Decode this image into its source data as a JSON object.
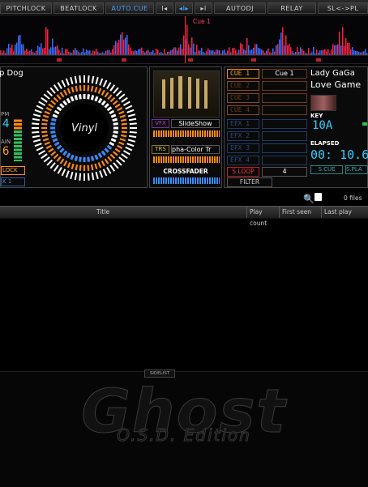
{
  "toolbar": {
    "buttons": [
      "PITCHLOCK",
      "BEATLOCK",
      "AUTO.CUE",
      "I◂",
      "◂I▸",
      "▸I",
      "AUTODJ",
      "RELAY",
      "SL<->PL"
    ]
  },
  "waveform": {
    "cue_label": "Cue 1"
  },
  "deck_left": {
    "title_fragment": "p Dog",
    "bpm_label": "PM",
    "bpm_digit": "4",
    "gain_label": "AIN",
    "gain_digit": "6",
    "lock_label": "LOCK",
    "bottom_label": "K 1",
    "platter_label": "Vinyl"
  },
  "mixer": {
    "vfx_label": "VFX",
    "vfx_value": "SlideShow",
    "trs_label": "TRS",
    "trs_value": "pha-Color Tr",
    "crossfader_label": "CROSSFADER"
  },
  "cues": {
    "buttons": [
      "CUE 1",
      "CUE 2",
      "CUE 3",
      "CUE 4"
    ],
    "slot1": "Cue 1",
    "efx": [
      "EFX 1",
      "EFX 2",
      "EFX 3",
      "EFX 4"
    ],
    "sloop_label": "S.LOOP",
    "sloop_value": "4",
    "filter_label": "FILTER"
  },
  "deck_right": {
    "artist": "Lady GaGa",
    "title": "Love Game",
    "key_label": "KEY",
    "key_value": "10A",
    "elapsed_label": "ELAPSED",
    "elapsed_value": "00: 10.6",
    "scue_label": "S.CUE",
    "splay_label": "S.PLA"
  },
  "browser": {
    "file_count": "0 files",
    "columns": [
      "Title",
      "Play count",
      "First seen",
      "Last play"
    ]
  },
  "branding": {
    "sidelist_label": "SIDELIST",
    "logo_main": "Ghost",
    "logo_sub": "O.S.D. Edition"
  },
  "colors": {
    "accent_blue": "#3a8cff",
    "accent_orange": "#ff8a10",
    "wave_red": "#ff2040",
    "wave_blue": "#3a6cff",
    "key_cyan": "#2ad0ff"
  }
}
